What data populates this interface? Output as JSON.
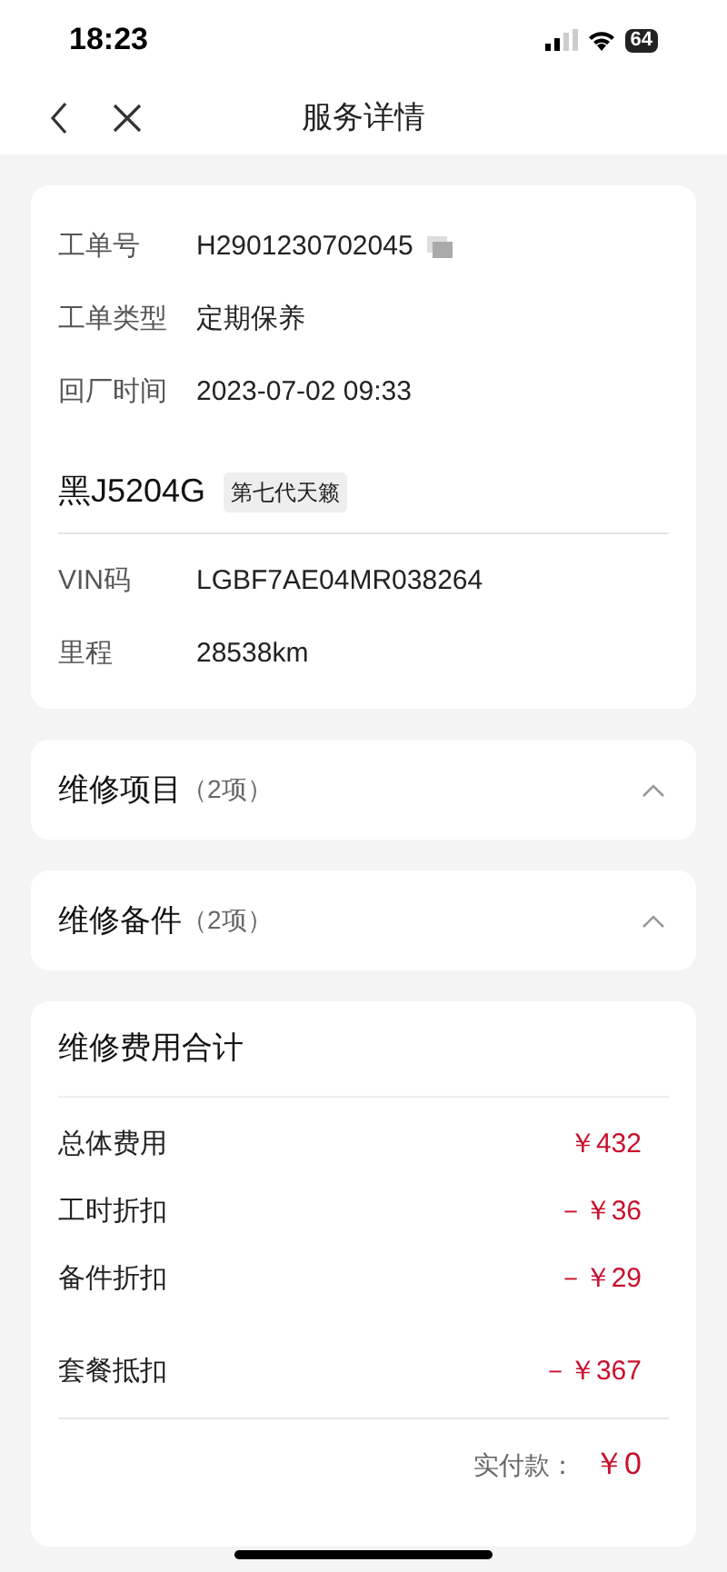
{
  "status_bar": {
    "time": "18:23",
    "battery": "64"
  },
  "nav": {
    "title": "服务详情"
  },
  "order": {
    "fields": [
      {
        "label": "工单号",
        "value": "H2901230702045",
        "copyable": true
      },
      {
        "label": "工单类型",
        "value": "定期保养",
        "copyable": false
      },
      {
        "label": "回厂时间",
        "value": "2023-07-02 09:33",
        "copyable": false
      }
    ],
    "plate": "黑J5204G",
    "model_tag": "第七代天籁",
    "vehicle_fields": [
      {
        "label": "VIN码",
        "value": "LGBF7AE04MR038264"
      },
      {
        "label": "里程",
        "value": "28538km"
      }
    ]
  },
  "sections": [
    {
      "title": "维修项目",
      "count": "（2项）"
    },
    {
      "title": "维修备件",
      "count": "（2项）"
    }
  ],
  "fees": {
    "title": "维修费用合计",
    "rows": [
      {
        "label": "总体费用",
        "amount": "￥432"
      },
      {
        "label": "工时折扣",
        "amount": "－￥36"
      },
      {
        "label": "备件折扣",
        "amount": "－￥29"
      },
      {
        "label": "套餐抵扣",
        "amount": "－￥367"
      }
    ],
    "paid_label": "实付款：",
    "paid_amount": "￥0"
  }
}
